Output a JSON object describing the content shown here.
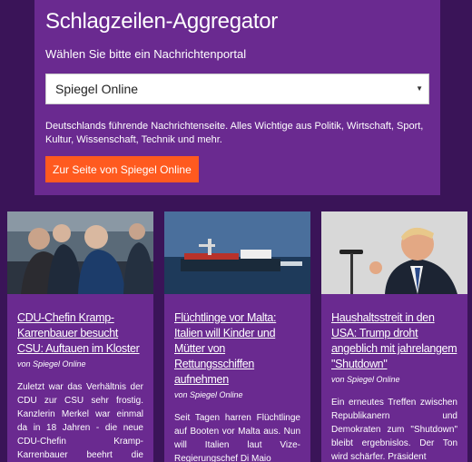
{
  "header": {
    "title": "Schlagzeilen-Aggregator",
    "select_label": "Wählen Sie bitte ein Nachrichtenportal",
    "selected_portal": "Spiegel Online",
    "description": "Deutschlands führende Nachrichtenseite. Alles Wichtige aus Politik, Wirtschaft, Sport, Kultur, Wissenschaft, Technik und mehr.",
    "button_label": "Zur Seite von Spiegel Online"
  },
  "articles": [
    {
      "title": "CDU-Chefin Kramp-Karrenbauer besucht CSU: Auftauen im Kloster",
      "source": "von Spiegel Online",
      "teaser": "Zuletzt war das Verhältnis der CDU zur CSU sehr frostig. Kanzlerin Merkel war einmal da in 18 Jahren - die neue CDU-Chefin Kramp-Karrenbauer beehrt die Neujahrsklausur"
    },
    {
      "title": "Flüchtlinge vor Malta: Italien will Kinder und Mütter von Rettungsschiffen aufnehmen",
      "source": "von Spiegel Online",
      "teaser": "Seit Tagen harren Flüchtlinge auf Booten vor Malta aus. Nun will Italien laut Vize-Regierungschef Di Maio"
    },
    {
      "title": "Haushaltsstreit in den USA: Trump droht angeblich mit jahrelangem \"Shutdown\"",
      "source": "von Spiegel Online",
      "teaser": "Ein erneutes Treffen zwischen Republikanern und Demokraten zum \"Shutdown\" bleibt ergebnislos. Der Ton wird schärfer. Präsident"
    }
  ],
  "colors": {
    "background": "#3a1458",
    "panel": "#6a2a90",
    "accent": "#ff5a1f"
  }
}
